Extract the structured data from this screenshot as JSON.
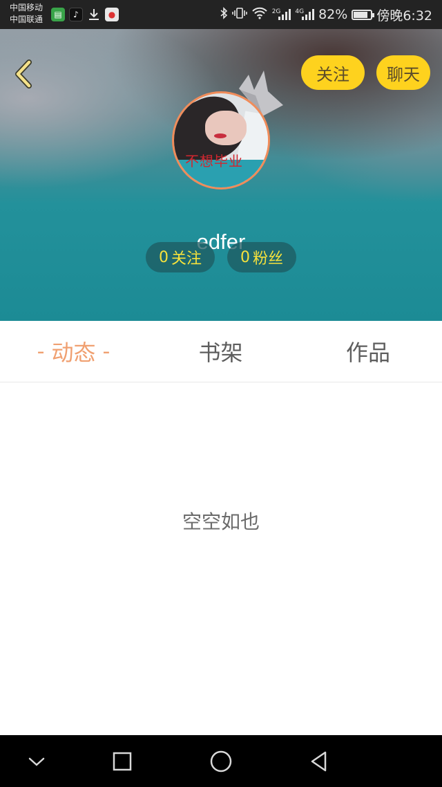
{
  "status_bar": {
    "carrier1": "中国移动",
    "carrier2": "中国联通",
    "network1": "2G",
    "network2": "4G",
    "battery": "82%",
    "battery_level": 0.82,
    "time": "傍晚6:32"
  },
  "profile": {
    "username": "edfer",
    "avatar_caption": "不想毕业",
    "following_count": "0",
    "following_label": "关注",
    "fans_count": "0",
    "fans_label": "粉丝"
  },
  "header_actions": {
    "follow_label": "关注",
    "chat_label": "聊天"
  },
  "tabs": [
    {
      "label": "动态",
      "active": true
    },
    {
      "label": "书架",
      "active": false
    },
    {
      "label": "作品",
      "active": false
    }
  ],
  "empty_text": "空空如也",
  "colors": {
    "accent_yellow": "#fed21e",
    "tab_active": "#f0a071",
    "stat_text": "#f6e23c"
  }
}
